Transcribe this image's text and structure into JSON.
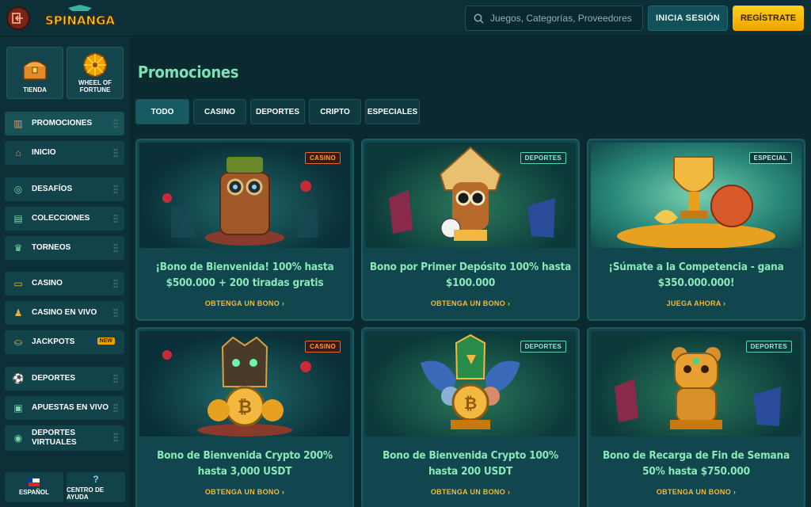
{
  "header": {
    "logo_text": "SPINANGA",
    "search_placeholder": "Juegos, Categorías, Proveedores",
    "login_label": "INICIA SESIÓN",
    "register_label": "REGÍSTRATE"
  },
  "sidebar": {
    "tiles": [
      {
        "label": "TIENDA",
        "icon": "chest-icon"
      },
      {
        "label": "WHEEL OF FORTUNE",
        "icon": "wheel-icon"
      }
    ],
    "items": [
      {
        "label": "PROMOCIONES",
        "icon": "gift-icon"
      },
      {
        "label": "INICIO",
        "icon": "home-icon"
      },
      {
        "label": "DESAFÍOS",
        "icon": "target-icon"
      },
      {
        "label": "COLECCIONES",
        "icon": "cards-icon"
      },
      {
        "label": "TORNEOS",
        "icon": "trophy-icon"
      },
      {
        "label": "CASINO",
        "icon": "casino-icon"
      },
      {
        "label": "CASINO EN VIVO",
        "icon": "dealer-icon"
      },
      {
        "label": "JACKPOTS",
        "icon": "coins-icon",
        "badge": "NEW"
      },
      {
        "label": "DEPORTES",
        "icon": "soccer-icon"
      },
      {
        "label": "APUESTAS EN VIVO",
        "icon": "live-icon"
      },
      {
        "label": "DEPORTES VIRTUALES",
        "icon": "virtual-icon"
      }
    ],
    "footer": {
      "language": "ESPAÑOL",
      "help": "CENTRO DE AYUDA"
    }
  },
  "main": {
    "title": "Promociones",
    "tabs": [
      "TODO",
      "CASINO",
      "DEPORTES",
      "CRIPTO",
      "ESPECIALES"
    ],
    "cards": [
      {
        "tag": "CASINO",
        "title": "¡Bono de Bienvenida! 100% hasta $500.000 + 200 tiradas gratis",
        "cta": "OBTENGA UN BONO"
      },
      {
        "tag": "DEPORTES",
        "title": "Bono por Primer Depósito 100% hasta $100.000",
        "cta": "OBTENGA UN BONO"
      },
      {
        "tag": "ESPECIAL",
        "title": "¡Súmate a la Competencia - gana $350.000.000!",
        "cta": "JUEGA AHORA"
      },
      {
        "tag": "CASINO",
        "title": "Bono de Bienvenida Crypto 200% hasta 3,000 USDT",
        "cta": "OBTENGA UN BONO"
      },
      {
        "tag": "DEPORTES",
        "title": "Bono de Bienvenida Crypto 100% hasta 200 USDT",
        "cta": "OBTENGA UN BONO"
      },
      {
        "tag": "DEPORTES",
        "title": "Bono de Recarga de Fin de Semana 50% hasta $750.000",
        "cta": "OBTENGA UN BONO"
      }
    ]
  },
  "colors": {
    "background": "#0b2a30",
    "accent_green": "#8ae8b8",
    "cta_gold": "#f2b840",
    "register_yellow": "#ffd11c"
  }
}
